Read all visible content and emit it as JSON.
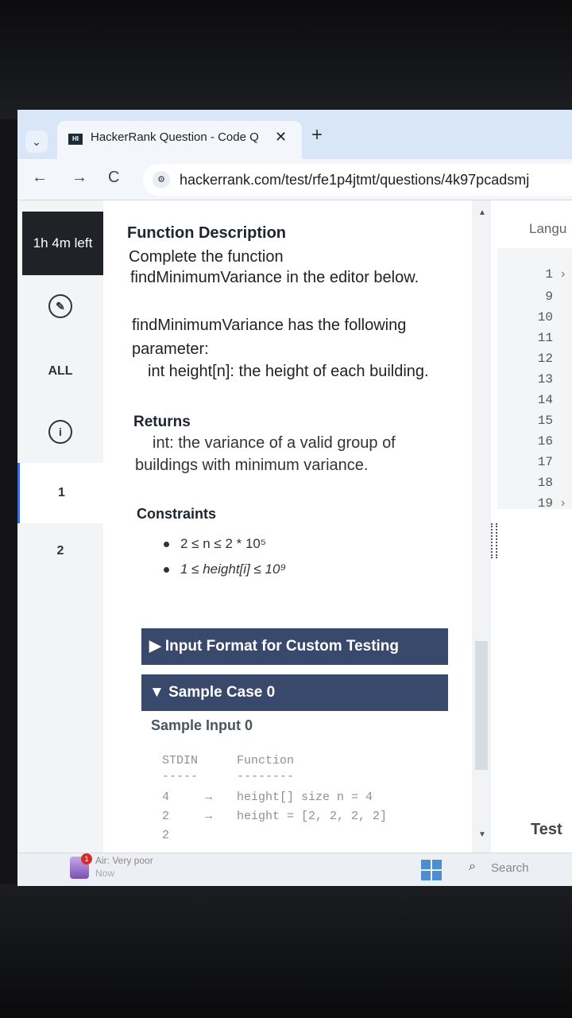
{
  "browser": {
    "tab_title": "HackerRank Question - Code Q",
    "tab_close": "✕",
    "new_tab": "+",
    "favicon_text": "HI",
    "url": "hackerrank.com/test/rfe1p4jtmt/questions/4k97pcadsmj",
    "back": "←",
    "forward": "→",
    "reload": "C",
    "dropdown": "⌄"
  },
  "sidebar": {
    "timer": "1h 4m left",
    "all_label": "ALL",
    "question_1": "1",
    "question_2": "2",
    "info_icon": "i"
  },
  "description": {
    "function_title": "Function Description",
    "complete_line": "Complete the function",
    "editor_line": "findMinimumVariance in the editor below.",
    "param_line_a": "findMinimumVariance has the following",
    "param_line_b": "parameter:",
    "param_line_c": "int height[n]: the height of each building.",
    "returns_title": "Returns",
    "returns_line_a": "int: the variance of a valid group of",
    "returns_line_b": "buildings with minimum variance.",
    "constraints_title": "Constraints",
    "constraint_1": "2 ≤ n ≤ 2 * 10⁵",
    "constraint_2": "1 ≤ height[i] ≤ 10⁹",
    "input_format_bar": "▶ Input Format for Custom Testing",
    "sample_case_bar": "▼ Sample Case 0",
    "sample_input_label": "Sample Input 0",
    "stdin_header": "STDIN",
    "function_header": "Function",
    "stdin_rule": "-----",
    "function_rule": "--------",
    "rows": [
      {
        "stdin": "4",
        "arrow": "→",
        "fn": "height[] size n = 4"
      },
      {
        "stdin": "2",
        "arrow": "→",
        "fn": "height = [2, 2, 2, 2]"
      },
      {
        "stdin": "2",
        "arrow": "",
        "fn": ""
      }
    ]
  },
  "editor": {
    "language_label": "Langu",
    "line_numbers": [
      "1",
      "9",
      "10",
      "11",
      "12",
      "13",
      "14",
      "15",
      "16",
      "17",
      "18",
      "19"
    ],
    "test_label": "Test"
  },
  "taskbar": {
    "weather_badge": "1",
    "weather_text": "Air: Very poor",
    "weather_sub": "Now",
    "search_text": "Search"
  }
}
